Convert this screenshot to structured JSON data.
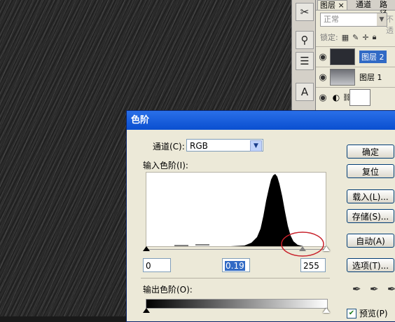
{
  "tools": [
    {
      "icon": "crossed-tools-icon"
    },
    {
      "icon": "brush-swap-icon"
    },
    {
      "icon": "list-icon"
    },
    {
      "icon": "text-tool-icon"
    }
  ],
  "layers_panel": {
    "tabs": [
      "图层",
      "通道",
      "路径"
    ],
    "tab_close": "×",
    "blend_mode": "正常",
    "opacity_label": "不透",
    "lock_label": "锁定:",
    "layers": [
      {
        "name": "图层 2",
        "selected": true
      },
      {
        "name": "图层 1",
        "selected": false
      },
      {
        "name": "",
        "selected": false
      }
    ]
  },
  "dialog": {
    "title": "色阶",
    "channel_label": "通道(C):",
    "channel_value": "RGB",
    "input_levels_label": "输入色阶(I):",
    "input_values": [
      "0",
      "0.19",
      "255"
    ],
    "output_levels_label": "输出色阶(O):",
    "buttons": {
      "ok": "确定",
      "reset": "复位",
      "load": "载入(L)...",
      "save": "存储(S)...",
      "auto": "自动(A)",
      "options": "选项(T)..."
    },
    "preview_label": "预览(P)",
    "preview_checked": true,
    "highlight_color": "#c8202a",
    "title_color": "#0a4fd0"
  }
}
